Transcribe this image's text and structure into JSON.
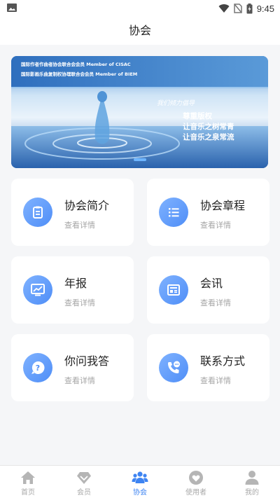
{
  "status_bar": {
    "time": "9:45"
  },
  "header": {
    "title": "协会"
  },
  "banner": {
    "line1": "国际作者作曲者协会联合会会员 Member of CISAC",
    "line2": "国际影画乐曲复制权协理联合会会员 Member of BIEM",
    "slogan_lead": "我们倾力倡导",
    "slogan1": "尊重版权",
    "slogan2": "让音乐之树常青",
    "slogan3": "让音乐之泉常流"
  },
  "cards": [
    {
      "title": "协会简介",
      "subtitle": "查看详情",
      "icon": "clipboard-icon"
    },
    {
      "title": "协会章程",
      "subtitle": "查看详情",
      "icon": "list-icon"
    },
    {
      "title": "年报",
      "subtitle": "查看详情",
      "icon": "chart-monitor-icon"
    },
    {
      "title": "会讯",
      "subtitle": "查看详情",
      "icon": "newspaper-icon"
    },
    {
      "title": "你问我答",
      "subtitle": "查看详情",
      "icon": "question-icon"
    },
    {
      "title": "联系方式",
      "subtitle": "查看详情",
      "icon": "phone-chat-icon"
    }
  ],
  "bottom_nav": {
    "items": [
      {
        "label": "首页",
        "icon": "home-icon"
      },
      {
        "label": "会员",
        "icon": "diamond-icon"
      },
      {
        "label": "协会",
        "icon": "group-icon"
      },
      {
        "label": "使用者",
        "icon": "heart-icon"
      },
      {
        "label": "我的",
        "icon": "person-icon"
      }
    ],
    "active_index": 2
  },
  "colors": {
    "accent": "#3e84f2",
    "card_bg": "#ffffff",
    "page_bg": "#f5f6f8",
    "muted_text": "#a6a6a6"
  }
}
